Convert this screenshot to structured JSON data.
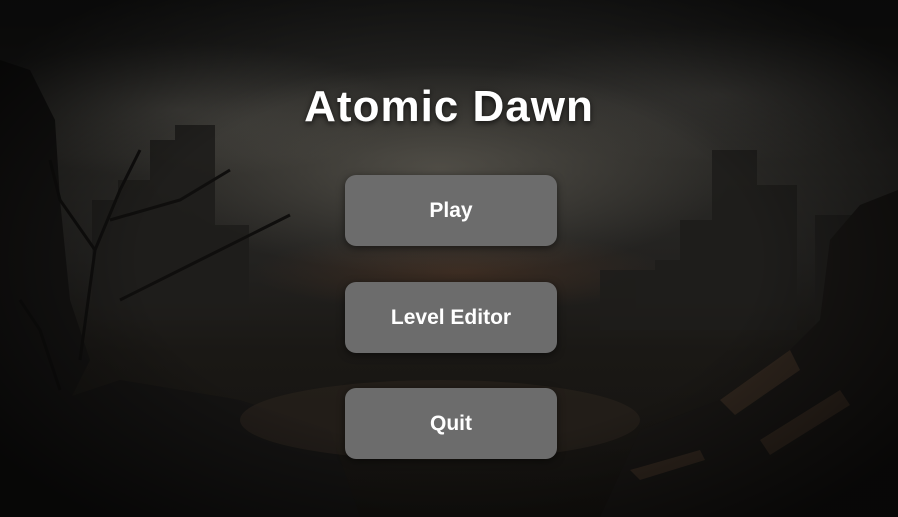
{
  "game": {
    "title": "Atomic Dawn"
  },
  "menu": {
    "play_label": "Play",
    "level_editor_label": "Level Editor",
    "quit_label": "Quit"
  },
  "colors": {
    "button_fill": "#6c6c6c",
    "button_text": "#ffffff",
    "title_text": "#ffffff",
    "sky": "#2b2a27",
    "ground": "#14120f"
  }
}
